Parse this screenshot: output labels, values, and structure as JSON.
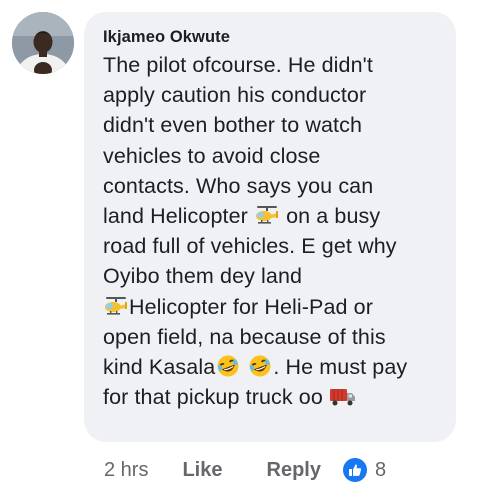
{
  "comment": {
    "author": "Ikjameo Okwute",
    "lines": [
      {
        "segments": [
          {
            "text": "The pilot ofcourse. He didn't"
          }
        ]
      },
      {
        "segments": [
          {
            "text": "apply caution his conductor"
          }
        ]
      },
      {
        "segments": [
          {
            "text": "didn't even bother to watch"
          }
        ]
      },
      {
        "segments": [
          {
            "text": "vehicles to avoid close"
          }
        ]
      },
      {
        "segments": [
          {
            "text": "contacts. Who says you can"
          }
        ]
      },
      {
        "segments": [
          {
            "text": "land Helicopter "
          },
          {
            "emoji": "helicopter-emoji"
          },
          {
            "text": " on a busy"
          }
        ]
      },
      {
        "segments": [
          {
            "text": "road full of vehicles. E get why"
          }
        ]
      },
      {
        "segments": [
          {
            "text": "Oyibo them dey land"
          }
        ]
      },
      {
        "segments": [
          {
            "emoji": "helicopter-emoji"
          },
          {
            "text": "Helicopter for Heli-Pad or"
          }
        ]
      },
      {
        "segments": [
          {
            "text": "open field, na because of this"
          }
        ]
      },
      {
        "segments": [
          {
            "text": "kind Kasala"
          },
          {
            "emoji": "rofl-emoji"
          },
          {
            "text": " "
          },
          {
            "emoji": "rofl-emoji"
          },
          {
            "text": ". He must pay"
          }
        ]
      },
      {
        "segments": [
          {
            "text": "for that pickup truck oo "
          },
          {
            "emoji": "truck-emoji"
          }
        ]
      }
    ]
  },
  "actions": {
    "time": "2 hrs",
    "like_label": "Like",
    "reply_label": "Reply",
    "reaction_icon": "thumbs-up-icon",
    "reaction_count": "8"
  },
  "colors": {
    "bubble": "#eff1f4",
    "text": "#1c1e21",
    "muted": "#65676b",
    "reaction_blue": "#1877f2"
  }
}
